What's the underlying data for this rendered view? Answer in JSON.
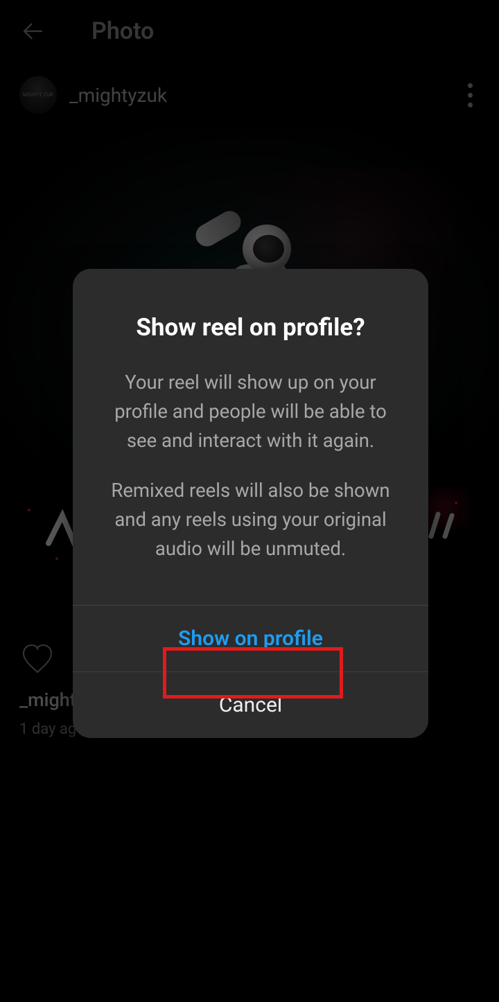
{
  "header": {
    "title": "Photo"
  },
  "post": {
    "username": "_mightyzuk",
    "avatar_text": "MIGHTY ZUK",
    "caption_username": "_might",
    "time": "1 day ag"
  },
  "dialog": {
    "title": "Show reel on profile?",
    "body_p1": "Your reel will show up on your profile and people will be able to see and interact with it again.",
    "body_p2": "Remixed reels will also be shown and any reels using your original audio will be unmuted.",
    "primary": "Show on profile",
    "secondary": "Cancel"
  }
}
